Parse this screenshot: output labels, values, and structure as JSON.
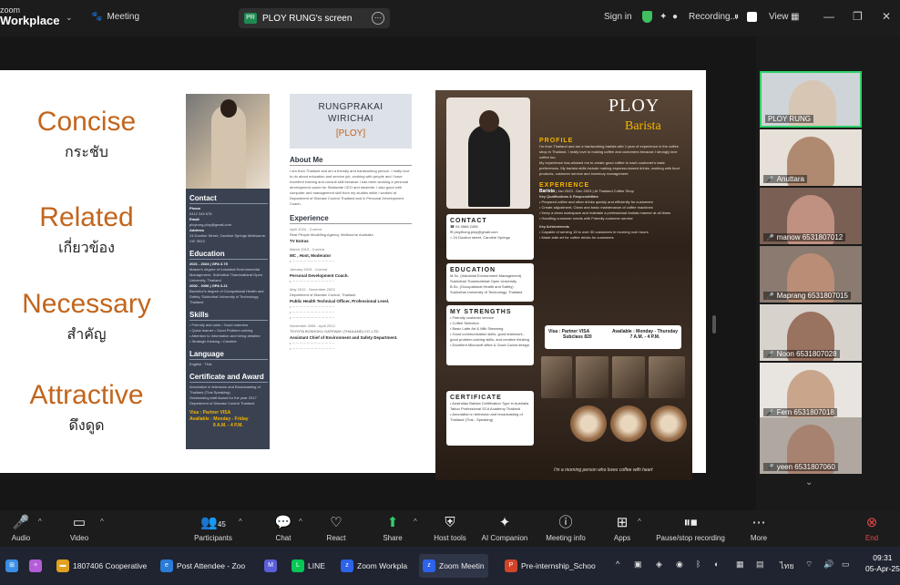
{
  "topbar": {
    "logo_line1": "zoom",
    "logo_line2": "Workplace",
    "meeting": "Meeting",
    "share_badge": "PR",
    "share_label": "PLOY RUNG's screen",
    "signin": "Sign in",
    "recording": "Recording...",
    "view": "View"
  },
  "slide": {
    "keywords": [
      {
        "en": "Concise",
        "th": "กระชับ"
      },
      {
        "en": "Related",
        "th": "เกี่ยวข้อง"
      },
      {
        "en": "Necessary",
        "th": "สำคัญ"
      },
      {
        "en": "Attractive",
        "th": "ดึงดูด"
      }
    ],
    "resume1": {
      "name1": "RUNGPRAKAI",
      "name2": "WIRICHAI",
      "nick": "[PLOY]",
      "contact_h": "Contact",
      "phone_l": "Phone",
      "phone_v": "0412 345 678",
      "email_l": "Email",
      "email_v": "ployrung.ploy@gmail.com",
      "address_l": "Address",
      "address_v": "24 Doulton Street, Caroline Springs Melbourne, VIC 3023",
      "education_h": "Education",
      "edu1": "2021 - 2024 | GPA 3.75",
      "edu1b": "Master's degree of Industrial Environmental Management, Sukhothai Thammathirat Open University, Thailand",
      "edu2": "2002 - 2006 | GPA 3.21",
      "edu2b": "Bachelor's degree of Occupational Health and Safety, Sukhothai University of Technology, Thailand",
      "skills_h": "Skills",
      "skills": [
        "Friendly and calm",
        "Good manners",
        "Quick learner",
        "Good Problem solving",
        "Attention to Information and being detailed",
        "Strategic thinking",
        "Creative"
      ],
      "language_h": "Language",
      "language": "English  ·  Thai",
      "cert_h": "Certificate and Award",
      "cert1": "Annotation in television and Broadcasting of Thailand (Thai Speaking)",
      "cert2": "Outstanding staff Award for the year 2017 Department of Disease Control Thailand",
      "visa": "Visa : Partner VISA",
      "avail": "Available : Monday - Friday",
      "avail_time": "8 A.M. - 4 P.M.",
      "about_h": "About Me",
      "about": "I am from Thailand and am a friendly and hardworking person. I really love to do about education and service job, working with people and I have excellent training and consult skill because I has been working a personal development coach for Statewide CEO and students. I also good with computer and management skill from my studies while I worked at Department of Disease Control Thailand and in Personal Development Coach.",
      "exp_h": "Experience",
      "exp": [
        {
          "date": "April 2024 - Current",
          "org": "Real People Modelling Agency, Melbourne Australia",
          "role": "TV Extras"
        },
        {
          "date": "March 2015 - Current",
          "org": "",
          "role": "MC , Host, Moderator"
        },
        {
          "date": "January 2015 - Current",
          "org": "",
          "role": "Personal Development Coach."
        },
        {
          "date": "May 2012 - November 2023",
          "org": "Department of Disease Control, Thailand",
          "role": "Public Health Technical Officer, Professional Level."
        },
        {
          "date": "November 2006 - April 2012",
          "org": "TOYOTA BOSHOKU GATEWAY (THAILAND) CO.,LTD.",
          "role": "Assistant Chief of Environment and Safety Department."
        }
      ]
    },
    "resume2": {
      "ploy": "PLOY",
      "barista": "Barista",
      "profile_h": "PROFILE",
      "profile": "I'm from Thailand and am a hardworking barista with 1 year of experience in the coffee shop in Thailand. I really love to making coffee and customers because I strongly love coffee too.",
      "profile2": "My experience has allowed me to create good coffee to each customer's taste preferences. My barista skills include making espresso-based drinks, working with food products, customer service and inventory management.",
      "exp_h": "EXPERIENCE",
      "exp_title": "Barista",
      "exp_date": "| Jan 2023 - Dec 2023 | At Thailand Coffee Shop",
      "key_h": "Key Qualifications & Responsibilities",
      "key": [
        "Prepared coffee and other drinks quickly and efficiently for customers",
        "Create adjustment, Clean and basic maintenance of coffee machines",
        "Keep a clean workspace and maintain a professional barista manner at all times",
        "Handling customer needs with Friendly customer service"
      ],
      "ach_h": "Key Achievements",
      "ach": [
        "Capable of serving 15 to over 30 customers in morning rush hours",
        "Made latte art for coffee drinks for customers"
      ],
      "contact_h": "CONTACT",
      "phone": "04 3566 2495",
      "email": "ploythong.ploy@gmail.com",
      "address": "24 Doulton street, Caroline Springs",
      "edu_h": "EDUCATION",
      "edu1": "M.Sc. (Industrial Environment Management) Sukhothai Thammathirat Open University",
      "edu2": "B.Sc. (Occupational Health and Safety) Sukhothai University of Technology, Thailand",
      "str_h": "MY STRENGTHS",
      "str": [
        "Friendly customer service",
        "Coffee Selection",
        "Basic Latte Art & Milk Steaming",
        "Good communication skills, good teamwork, good problem-solving skills, and creative thinking",
        "Excellent Microsoft office & Good Canva design"
      ],
      "cert_h": "CERTIFICATE",
      "cert": [
        "Australian Barista Certification Type in Australia Tattoo Professional SCA Academy Thailand",
        "Annotation in television and broadcasting of Thailand (Thai - Speaking)"
      ],
      "visa": "Visa : Partner VISA",
      "subclass": "Subclass 820",
      "avail": "Available : Monday - Thursday",
      "avail_time": "7 A.M. - 4 P.M.",
      "footer": "I'm a morning person who loves coffee with heart"
    }
  },
  "participants": [
    {
      "name": "PLOY RUNG",
      "muted": false,
      "color": "#d8c6b4",
      "bg": "#cfd4d8"
    },
    {
      "name": "Anuttara",
      "muted": true,
      "color": "#b08a70",
      "bg": "#e6e0d8"
    },
    {
      "name": "manow 6531807012",
      "muted": true,
      "color": "#c09080",
      "bg": "#7a5f55"
    },
    {
      "name": "Maprang 6531807015",
      "muted": true,
      "color": "#b98d76",
      "bg": "#8a7a70"
    },
    {
      "name": "Noon 6531807028",
      "muted": true,
      "color": "#9a7260",
      "bg": "#d8d2cc"
    },
    {
      "name": "Fern 6531807018",
      "muted": true,
      "color": "#c9a58c",
      "bg": "#e8e4e0"
    },
    {
      "name": "yeen 6531807060",
      "muted": true,
      "color": "#a88270",
      "bg": "#b0a8a0"
    }
  ],
  "toolbar": {
    "audio": "Audio",
    "video": "Video",
    "participants": "Participants",
    "participants_count": "45",
    "chat": "Chat",
    "react": "React",
    "share": "Share",
    "host_tools": "Host tools",
    "ai": "AI Companion",
    "meeting_info": "Meeting info",
    "apps": "Apps",
    "pause": "Pause/stop recording",
    "more": "More",
    "end": "End"
  },
  "taskbar": {
    "tasks": [
      {
        "label": "1807406 Cooperative",
        "color": "#e0a020"
      },
      {
        "label": "Post Attendee - Zoo",
        "color": "#2b7bd8"
      },
      {
        "label": "",
        "color": "#5b5fd8"
      },
      {
        "label": "LINE",
        "color": "#06c755"
      },
      {
        "label": "Zoom Workpla",
        "color": "#2d63ea"
      },
      {
        "label": "Zoom Meetin",
        "color": "#2d63ea"
      },
      {
        "label": "Pre-internship_Schoo",
        "color": "#d0452a"
      }
    ],
    "lang": "ไทย",
    "time": "09:31",
    "date": "05-Apr-25"
  }
}
